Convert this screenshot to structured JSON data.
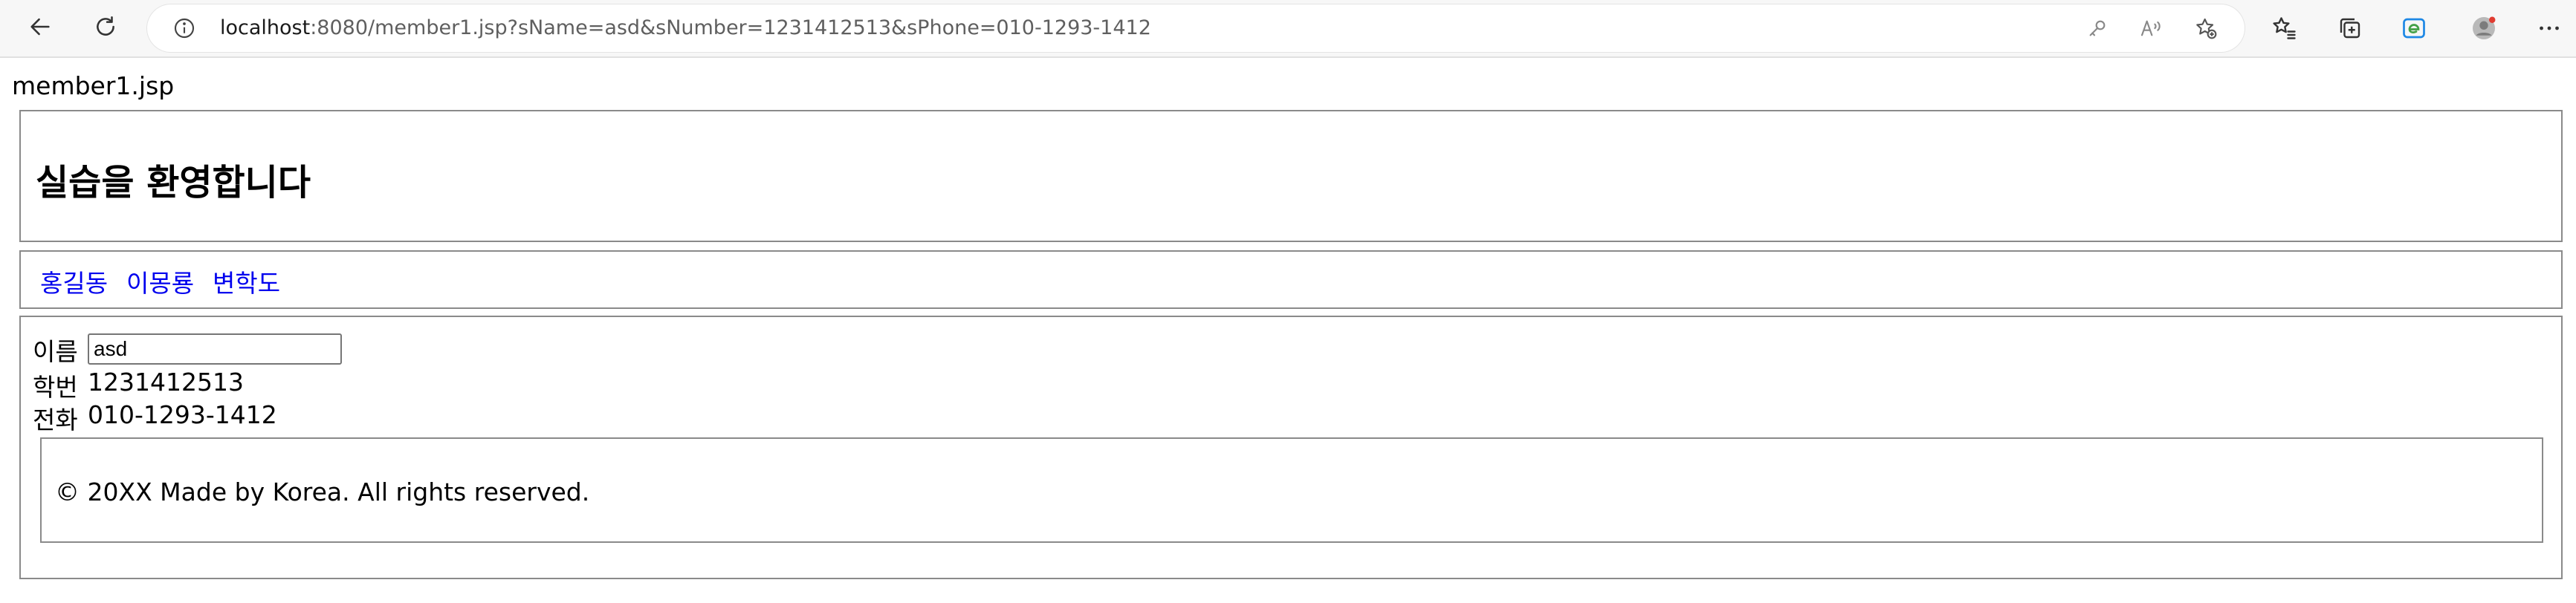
{
  "browser": {
    "url_host": "localhost",
    "url_rest": ":8080/member1.jsp?sName=asd&sNumber=1231412513&sPhone=010-1293-1412",
    "icons": {
      "back": "back-arrow-icon",
      "refresh": "refresh-icon",
      "site_info": "info-icon",
      "password": "key-icon",
      "read_aloud": "read-aloud-icon",
      "add_favorite": "star-add-icon",
      "favorites": "favorites-list-icon",
      "collections": "collections-icon",
      "edge": "edge-icon",
      "profile": "profile-avatar-icon",
      "more": "more-dots-icon"
    },
    "profile_badge_color": "#e03c31"
  },
  "page": {
    "label": "member1.jsp",
    "heading": "실습을 환영합니다",
    "nav_links": [
      "홍길동",
      "이몽룡",
      "변학도"
    ],
    "link_color": "#0000ee",
    "form": {
      "name_label": "이름",
      "name_value": "asd",
      "number_label": "학번",
      "number_value": "1231412513",
      "phone_label": "전화",
      "phone_value": "010-1293-1412"
    },
    "footer": "© 20XX Made by Korea. All rights reserved."
  }
}
